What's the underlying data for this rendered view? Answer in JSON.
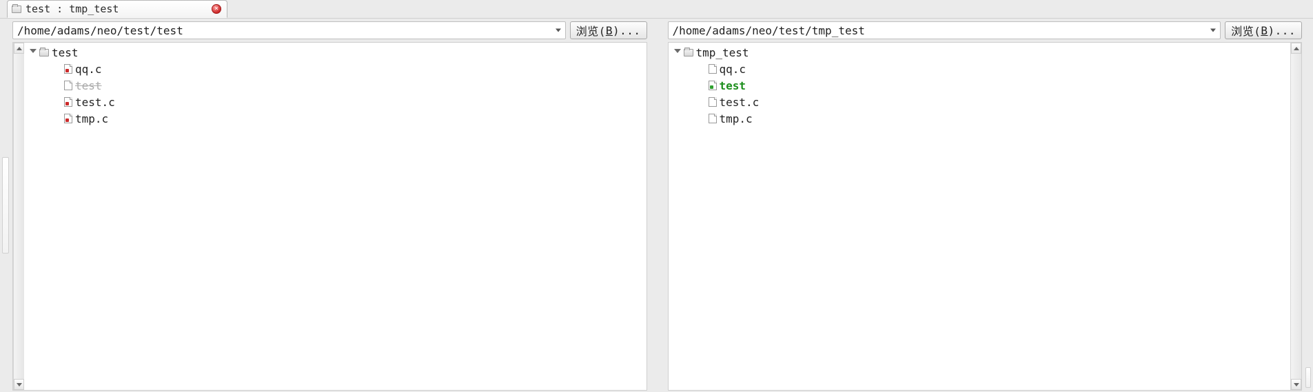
{
  "tab": {
    "title": "test : tmp_test"
  },
  "browse_label_prefix": "浏览(",
  "browse_label_hotkey": "B",
  "browse_label_suffix": ")...",
  "left": {
    "path": "/home/adams/neo/test/test",
    "root": {
      "name": "test"
    },
    "files": [
      {
        "name": "qq.c",
        "status": "modified"
      },
      {
        "name": "test",
        "status": "deleted"
      },
      {
        "name": "test.c",
        "status": "modified"
      },
      {
        "name": "tmp.c",
        "status": "modified"
      }
    ]
  },
  "right": {
    "path": "/home/adams/neo/test/tmp_test",
    "root": {
      "name": "tmp_test"
    },
    "files": [
      {
        "name": "qq.c",
        "status": "normal"
      },
      {
        "name": "test",
        "status": "added"
      },
      {
        "name": "test.c",
        "status": "normal"
      },
      {
        "name": "tmp.c",
        "status": "normal"
      }
    ]
  }
}
